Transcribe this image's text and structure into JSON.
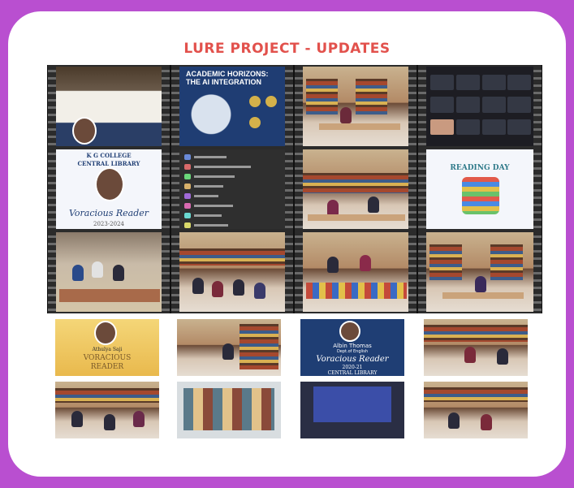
{
  "title": "LURE PROJECT - UPDATES",
  "colors": {
    "background": "#b94fd0",
    "frame": "#ffffff",
    "title": "#e2514c",
    "filmstrip": "#2b2b2b"
  },
  "posters": {
    "ai": {
      "line1": "ACADEMIC HORIZONS:",
      "line2": "THE AI INTEGRATION"
    },
    "kg": {
      "college": "K G COLLEGE",
      "library": "CENTRAL LIBRARY",
      "reader": "Voracious Reader",
      "year": "2023-2024"
    },
    "reading": {
      "title": "READING DAY"
    },
    "athulya": {
      "name": "Athulya Saji",
      "line1": "VORACIOUS",
      "line2": "READER"
    },
    "albin": {
      "name": "Albin Thomas",
      "dept": "Dept.of English",
      "reader": "Voracious Reader",
      "year": "2020-21",
      "library": "CENTRAL LIBRARY"
    }
  }
}
